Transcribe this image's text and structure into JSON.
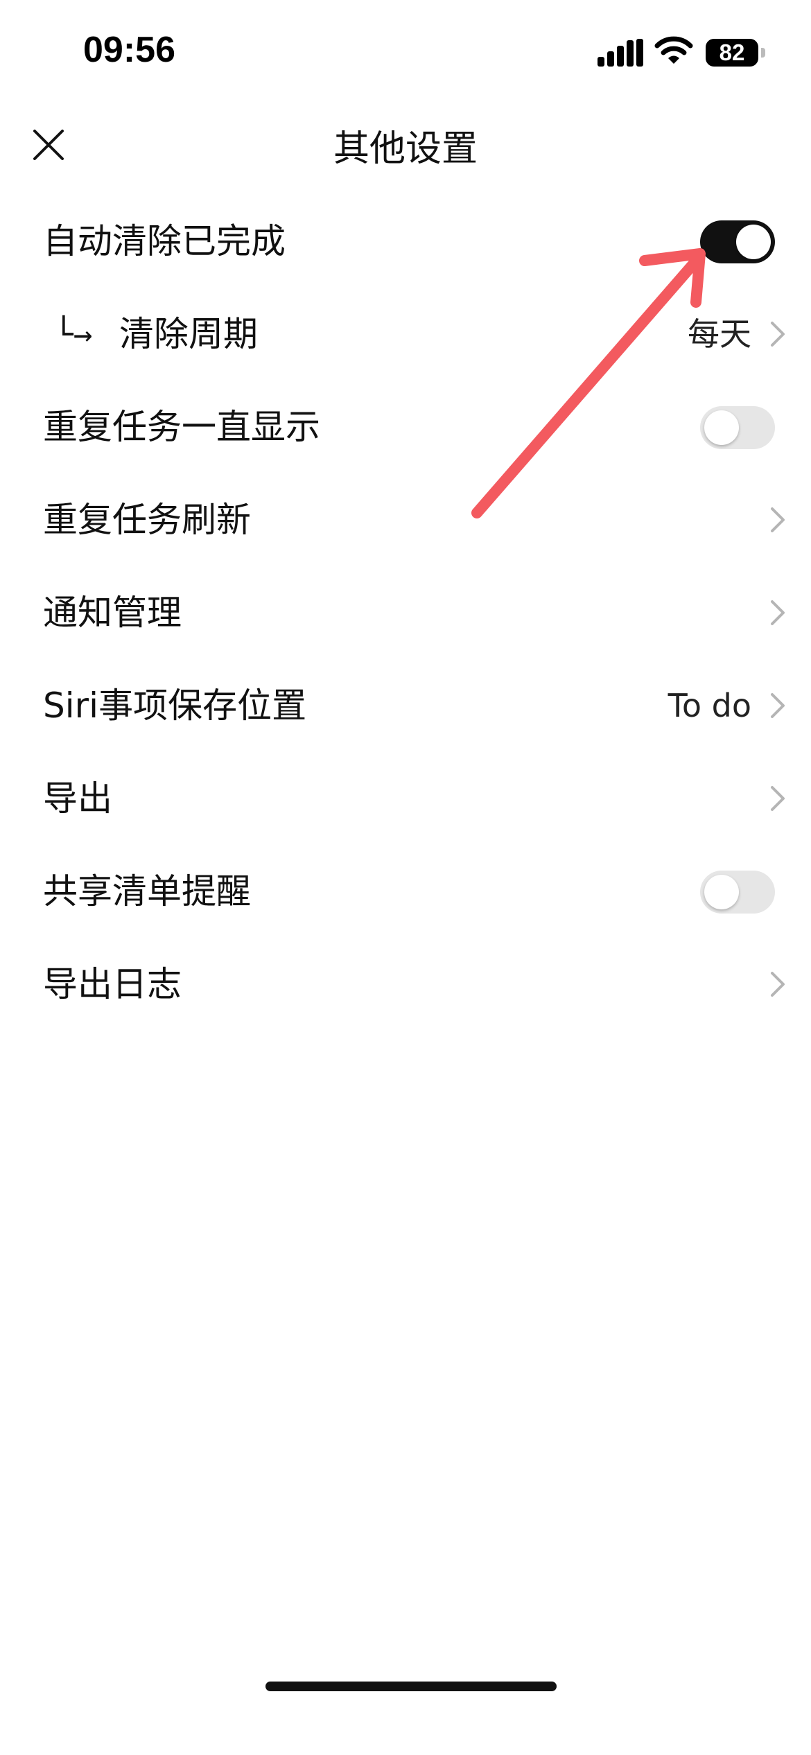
{
  "status_bar": {
    "time": "09:56",
    "battery": "82",
    "icons": [
      "cellular-signal-icon",
      "wifi-icon",
      "battery-icon"
    ]
  },
  "header": {
    "title": "其他设置",
    "close_icon": "close-icon"
  },
  "settings": {
    "auto_clear": {
      "label": "自动清除已完成",
      "toggle_on": true
    },
    "clear_period": {
      "prefix": "└→",
      "label": "清除周期",
      "value": "每天"
    },
    "repeat_show": {
      "label": "重复任务一直显示",
      "toggle_on": false
    },
    "repeat_refresh": {
      "label": "重复任务刷新"
    },
    "notifications": {
      "label": "通知管理"
    },
    "siri_location": {
      "label": "Siri事项保存位置",
      "value": "To do"
    },
    "export": {
      "label": "导出"
    },
    "shared_reminder": {
      "label": "共享清单提醒",
      "toggle_on": false
    },
    "export_log": {
      "label": "导出日志"
    }
  },
  "colors": {
    "toggle_on": "#111111",
    "toggle_off": "#e6e6e6",
    "annotation_arrow": "#f35a5f",
    "chevron": "#b5b5b5"
  }
}
